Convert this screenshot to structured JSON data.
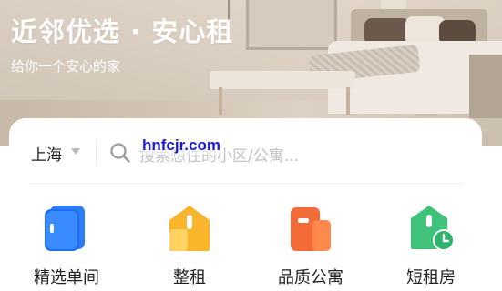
{
  "hero": {
    "title": "近邻优选 · 安心租",
    "subtitle": "给你一个安心的家"
  },
  "search": {
    "city": "上海",
    "placeholder": "搜索想住的小区/公寓..."
  },
  "watermark": "hnfcjr.com",
  "categories": [
    {
      "label": "精选单间",
      "icon": "phone-door-icon",
      "color": "#2f7df6"
    },
    {
      "label": "整租",
      "icon": "house-icon",
      "color": "#f9b52b"
    },
    {
      "label": "品质公寓",
      "icon": "apartment-icon",
      "color": "#f46b3a"
    },
    {
      "label": "短租房",
      "icon": "house-clock-icon",
      "color": "#3fc37a"
    }
  ]
}
